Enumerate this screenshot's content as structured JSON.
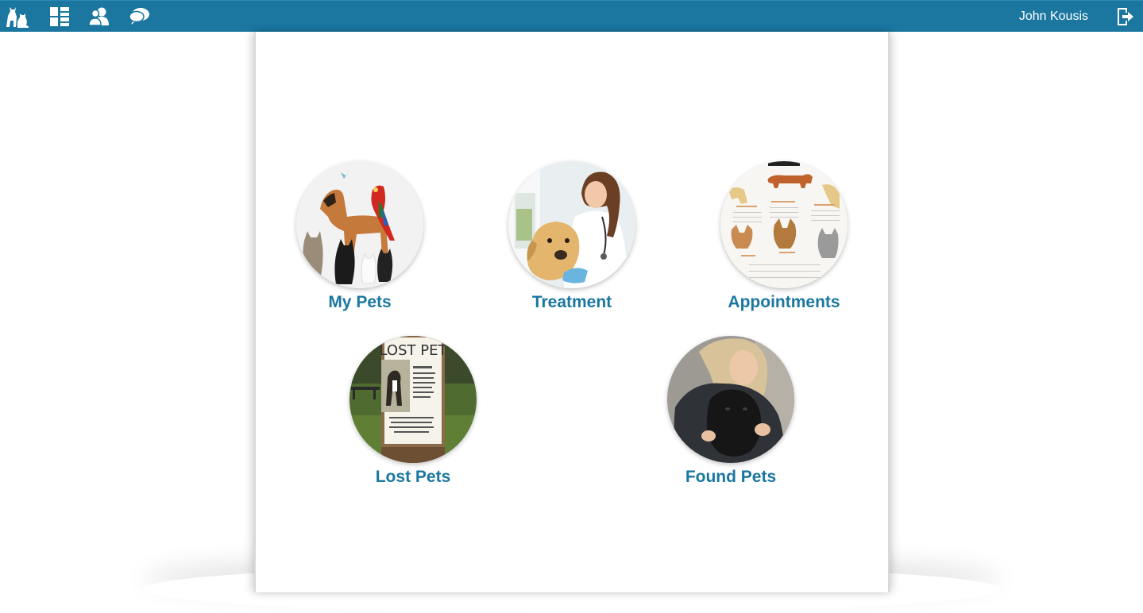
{
  "topbar": {
    "background": "#1b77a0",
    "icons": [
      "pets-logo-icon",
      "dashboard-icon",
      "users-icon",
      "chat-icon"
    ],
    "user_name": "John Kousis",
    "logout_icon": "logout-icon"
  },
  "tiles": [
    {
      "label": "My Pets",
      "image": "pets-group-photo"
    },
    {
      "label": "Treatment",
      "image": "vet-with-dog-photo"
    },
    {
      "label": "Appointments",
      "image": "dog-calendar-photo"
    },
    {
      "label": "Lost Pets",
      "image": "lost-pet-poster-photo"
    },
    {
      "label": "Found Pets",
      "image": "woman-holding-puppy-photo"
    }
  ],
  "lost_poster": {
    "heading": "LOST PET"
  },
  "colors": {
    "accent": "#1b77a0",
    "page": "#ffffff"
  }
}
